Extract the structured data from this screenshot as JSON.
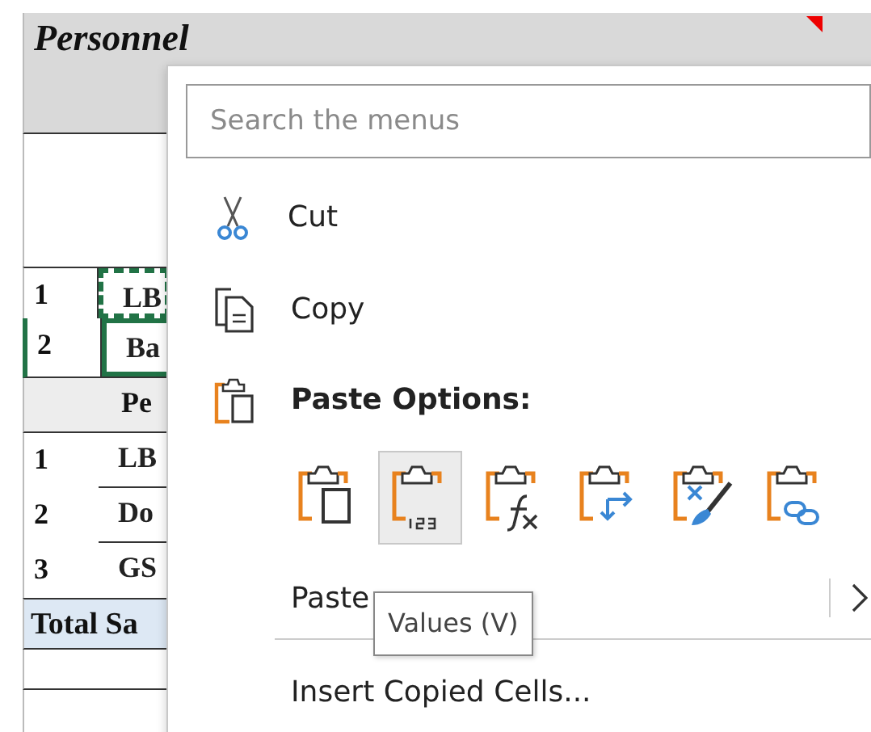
{
  "sheet": {
    "title": "Personnel",
    "comment_marker": true,
    "rows": [
      {
        "number": "1",
        "name": "LB",
        "kind": "copied"
      },
      {
        "number": "2",
        "name": "Ba",
        "kind": "selected"
      }
    ],
    "subheading": "Pe",
    "rows2": [
      {
        "number": "1",
        "name": "LB"
      },
      {
        "number": "2",
        "name": "Do"
      },
      {
        "number": "3",
        "name": "GS"
      }
    ],
    "total": "Total Sa"
  },
  "context_menu": {
    "search": {
      "placeholder": "Search the menus"
    },
    "items": [
      {
        "kind": "cut",
        "label": "Cut"
      },
      {
        "kind": "copy",
        "label": "Copy"
      },
      {
        "kind": "heading",
        "label": "Paste Options:"
      }
    ],
    "paste_options": [
      {
        "kind": "keep",
        "selected": false
      },
      {
        "kind": "values",
        "selected": true
      },
      {
        "kind": "formulas",
        "selected": false
      },
      {
        "kind": "transpose",
        "selected": false
      },
      {
        "kind": "formatting",
        "selected": false
      },
      {
        "kind": "link",
        "selected": false
      }
    ],
    "paste_special": {
      "label": "Paste",
      "has_submenu": true
    },
    "tooltip": "Values (V)",
    "insert": "Insert Copied Cells..."
  }
}
